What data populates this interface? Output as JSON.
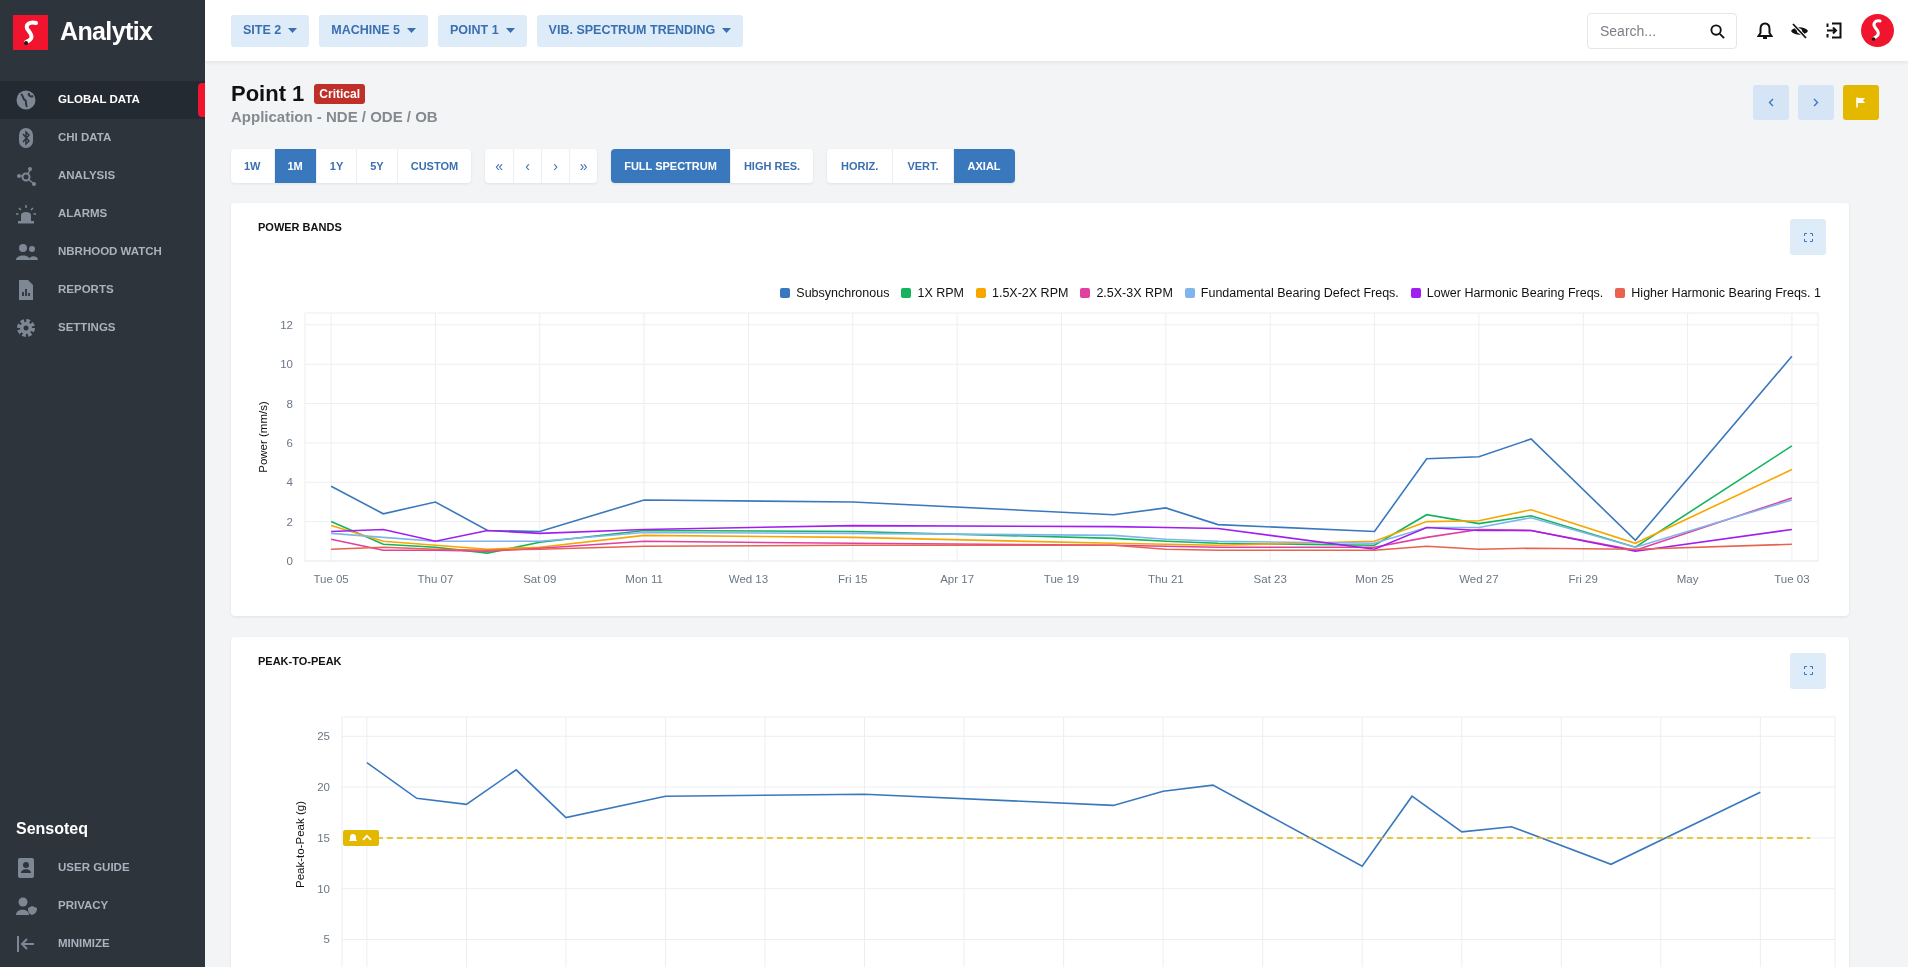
{
  "sidebar": {
    "brand": "Analytix",
    "items": [
      {
        "label": "GLOBAL DATA",
        "selected": true
      },
      {
        "label": "CHI DATA",
        "selected": false
      },
      {
        "label": "ANALYSIS",
        "selected": false
      },
      {
        "label": "ALARMS",
        "selected": false
      },
      {
        "label": "NBRHOOD WATCH",
        "selected": false
      },
      {
        "label": "REPORTS",
        "selected": false
      },
      {
        "label": "SETTINGS",
        "selected": false
      }
    ],
    "footer_title": "Sensoteq",
    "footer_items": [
      {
        "label": "USER GUIDE"
      },
      {
        "label": "PRIVACY"
      },
      {
        "label": "MINIMIZE"
      }
    ]
  },
  "topbar": {
    "breadcrumbs": [
      "SITE 2",
      "MACHINE 5",
      "POINT 1",
      "VIB. SPECTRUM TRENDING"
    ],
    "search": {
      "placeholder": "Search..."
    }
  },
  "header": {
    "title": "Point 1",
    "badge": "Critical",
    "subtitle": "Application - NDE / ODE / OB"
  },
  "range_buttons": [
    {
      "label": "1W",
      "selected": false
    },
    {
      "label": "1M",
      "selected": true
    },
    {
      "label": "1Y",
      "selected": false
    },
    {
      "label": "5Y",
      "selected": false
    },
    {
      "label": "CUSTOM",
      "selected": false
    }
  ],
  "nav_buttons": [
    "«",
    "‹",
    "›",
    "»"
  ],
  "spectrum_buttons": [
    {
      "label": "FULL SPECTRUM",
      "selected": true
    },
    {
      "label": "HIGH RES.",
      "selected": false
    }
  ],
  "axis_buttons": [
    {
      "label": "HORIZ.",
      "selected": false
    },
    {
      "label": "VERT.",
      "selected": false
    },
    {
      "label": "AXIAL",
      "selected": true
    }
  ],
  "charts": [
    {
      "title": "POWER BANDS",
      "chart_data": {
        "type": "line",
        "ylabel": "Power (mm/s)",
        "grid": true,
        "categories": [
          "Tue 05",
          null,
          "Thu 07",
          null,
          "Sat 09",
          null,
          "Mon 11",
          null,
          "Wed 13",
          null,
          "Fri 15",
          null,
          "Apr 17",
          null,
          "Tue 19",
          null,
          "Thu 21",
          null,
          "Sat 23",
          null,
          "Mon 25",
          null,
          "Wed 27",
          null,
          "Fri 29",
          null,
          "May",
          null,
          "Tue 03"
        ],
        "ylim": [
          0,
          12.6
        ],
        "yticks": [
          0,
          2,
          4,
          6,
          8,
          10,
          12
        ],
        "series": [
          {
            "name": "Subsynchronous",
            "color": "#3a78bd",
            "values": [
              3.8,
              2.4,
              3.0,
              1.55,
              1.5,
              null,
              3.1,
              null,
              null,
              null,
              3.0,
              null,
              null,
              null,
              null,
              2.35,
              2.7,
              1.85,
              null,
              null,
              1.5,
              5.2,
              5.3,
              6.2,
              null,
              1.05,
              null,
              null,
              10.4
            ]
          },
          {
            "name": "1X RPM",
            "color": "#14b35e",
            "values": [
              2.0,
              0.85,
              0.7,
              0.4,
              0.95,
              null,
              1.55,
              null,
              null,
              null,
              1.5,
              null,
              null,
              null,
              null,
              1.15,
              1.0,
              0.9,
              null,
              null,
              0.8,
              2.35,
              1.9,
              2.3,
              null,
              0.7,
              null,
              null,
              5.85
            ]
          },
          {
            "name": "1.5X-2X RPM",
            "color": "#f7a600",
            "values": [
              1.8,
              1.0,
              0.8,
              0.6,
              0.7,
              null,
              1.3,
              null,
              null,
              null,
              1.2,
              null,
              null,
              null,
              null,
              0.9,
              0.85,
              0.8,
              null,
              null,
              1.0,
              2.0,
              2.05,
              2.6,
              null,
              0.9,
              null,
              null,
              4.65
            ]
          },
          {
            "name": "2.5X-3X RPM",
            "color": "#e040a0",
            "values": [
              1.1,
              0.55,
              0.55,
              0.5,
              0.65,
              null,
              1.0,
              null,
              null,
              null,
              0.9,
              null,
              null,
              null,
              null,
              0.8,
              0.75,
              0.7,
              null,
              null,
              0.7,
              1.2,
              1.6,
              1.55,
              null,
              0.55,
              null,
              null,
              3.2
            ]
          },
          {
            "name": "Fundamental Bearing Defect Freqs.",
            "color": "#7fb5ec",
            "values": [
              1.4,
              1.2,
              1.0,
              1.0,
              1.0,
              null,
              1.45,
              null,
              null,
              null,
              1.4,
              null,
              null,
              null,
              null,
              1.3,
              1.1,
              1.0,
              null,
              null,
              0.9,
              1.7,
              1.7,
              2.2,
              null,
              0.7,
              null,
              null,
              3.1
            ]
          },
          {
            "name": "Lower Harmonic Bearing Freqs.",
            "color": "#a11ef0",
            "values": [
              1.5,
              1.6,
              1.0,
              1.55,
              1.4,
              null,
              1.6,
              null,
              null,
              null,
              1.8,
              null,
              null,
              null,
              null,
              1.75,
              1.7,
              1.65,
              null,
              null,
              0.6,
              1.7,
              1.55,
              1.55,
              null,
              0.5,
              null,
              null,
              1.6
            ]
          },
          {
            "name": "Higher Harmonic Bearing Freqs. 1",
            "color": "#e8634f",
            "values": [
              0.6,
              0.7,
              0.6,
              0.55,
              0.6,
              null,
              0.75,
              null,
              null,
              null,
              0.8,
              null,
              null,
              null,
              null,
              0.8,
              0.6,
              0.55,
              null,
              null,
              0.55,
              0.75,
              0.6,
              0.65,
              null,
              0.6,
              null,
              null,
              0.85
            ]
          }
        ]
      }
    },
    {
      "title": "PEAK-TO-PEAK",
      "chart_data": {
        "type": "line",
        "ylabel": "Peak-to-Peak (g)",
        "grid": true,
        "categories": [
          null,
          null,
          null,
          null,
          null,
          null,
          null,
          null,
          null,
          null,
          null,
          null,
          null,
          null,
          null,
          null,
          null,
          null,
          null,
          null,
          null,
          null,
          null,
          null,
          null,
          null,
          null,
          null,
          null,
          null
        ],
        "ylim": [
          1.8,
          26.9
        ],
        "yticks": [
          5,
          10,
          15,
          20,
          25
        ],
        "series": [
          {
            "color": "#3a78bd",
            "values": [
              22.4,
              18.9,
              18.3,
              21.7,
              17.0,
              null,
              19.1,
              null,
              null,
              null,
              19.3,
              null,
              null,
              null,
              null,
              18.2,
              19.6,
              20.2,
              null,
              null,
              12.2,
              19.1,
              15.6,
              16.1,
              null,
              12.4,
              null,
              null,
              19.5,
              null
            ]
          },
          {
            "color": "#e5b800",
            "line_style": "dashed",
            "values": [
              15,
              15,
              15,
              15,
              15,
              15,
              15,
              15,
              15,
              15,
              15,
              15,
              15,
              15,
              15,
              15,
              15,
              15,
              15,
              15,
              15,
              15,
              15,
              15,
              15,
              15,
              15,
              15,
              15,
              15
            ]
          }
        ]
      }
    }
  ]
}
